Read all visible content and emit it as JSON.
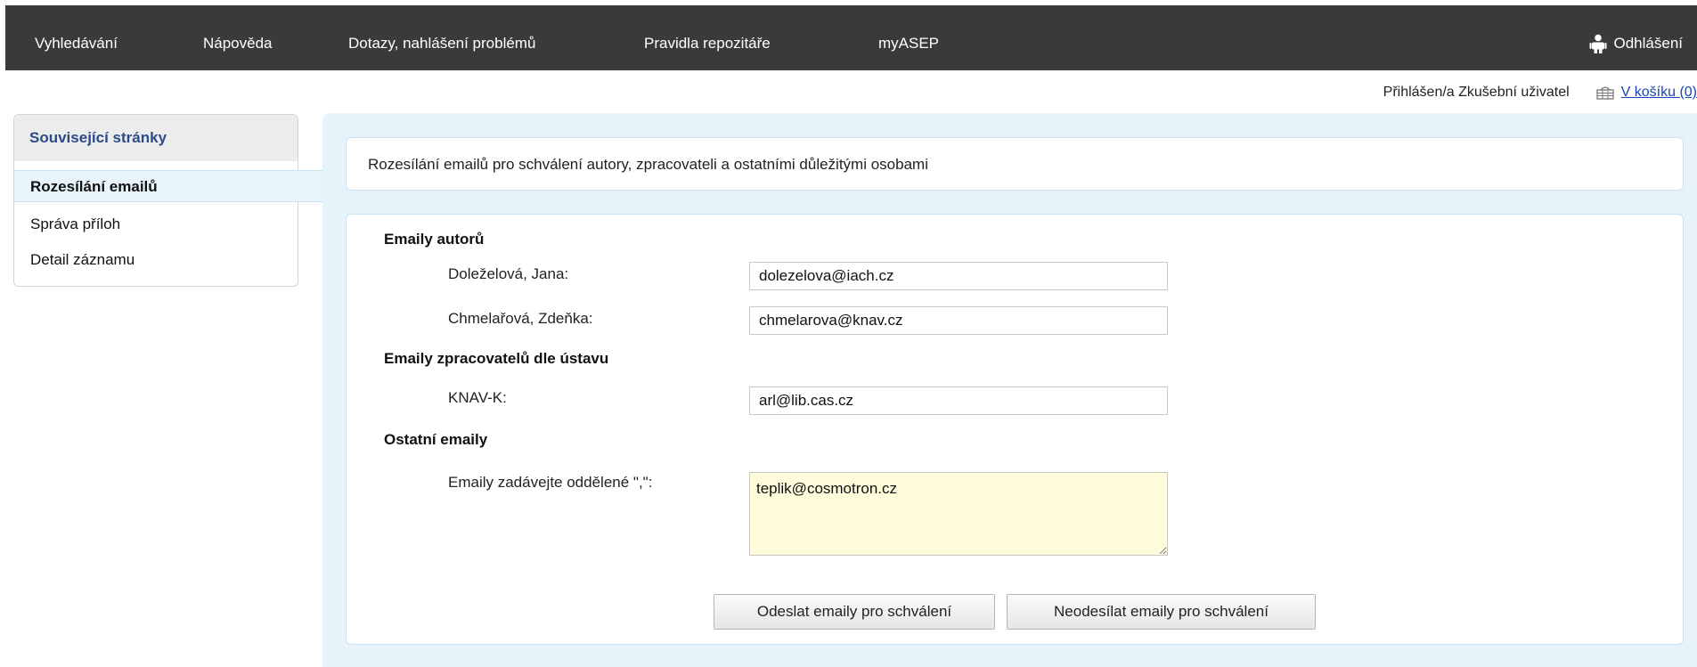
{
  "nav": {
    "items": [
      {
        "label": "Vyhledávání"
      },
      {
        "label": "Nápověda"
      },
      {
        "label": "Dotazy, nahlášení problémů"
      },
      {
        "label": "Pravidla repozitáře"
      },
      {
        "label": "myASEP"
      }
    ],
    "logout_label": "Odhlášení",
    "logout_icon": "user-icon"
  },
  "status": {
    "logged_in": "Přihlášen/a Zkušební uživatel",
    "cart_label": "V košíku (0)",
    "cart_icon": "basket-icon"
  },
  "sidebar": {
    "title": "Související stránky",
    "active_item": "Rozesílání emailů",
    "items": [
      {
        "label": "Správa příloh"
      },
      {
        "label": "Detail záznamu"
      }
    ]
  },
  "main": {
    "info": "Rozesílání emailů pro schválení autory, zpracovateli a ostatními důležitými osobami",
    "sections": {
      "authors_title": "Emaily autorů",
      "authors": [
        {
          "name": "Doleželová, Jana:",
          "email": "dolezelova@iach.cz"
        },
        {
          "name": "Chmelařová, Zdeňka:",
          "email": "chmelarova@knav.cz"
        }
      ],
      "processors_title": "Emaily zpracovatelů dle ústavu",
      "processors": [
        {
          "name": "KNAV-K:",
          "email": "arl@lib.cas.cz"
        }
      ],
      "other_title": "Ostatní emaily",
      "other_label": "Emaily zadávejte oddělené \",\":",
      "other_value": "teplik@cosmotron.cz"
    },
    "buttons": {
      "send": "Odeslat emaily pro schválení",
      "dont_send": "Neodesílat emaily pro schválení"
    }
  },
  "colors": {
    "nav_bg": "#3a3a3a",
    "panel_bg": "#e6f3fb",
    "textarea_bg": "#fffcdc",
    "link": "#1a44b8"
  }
}
